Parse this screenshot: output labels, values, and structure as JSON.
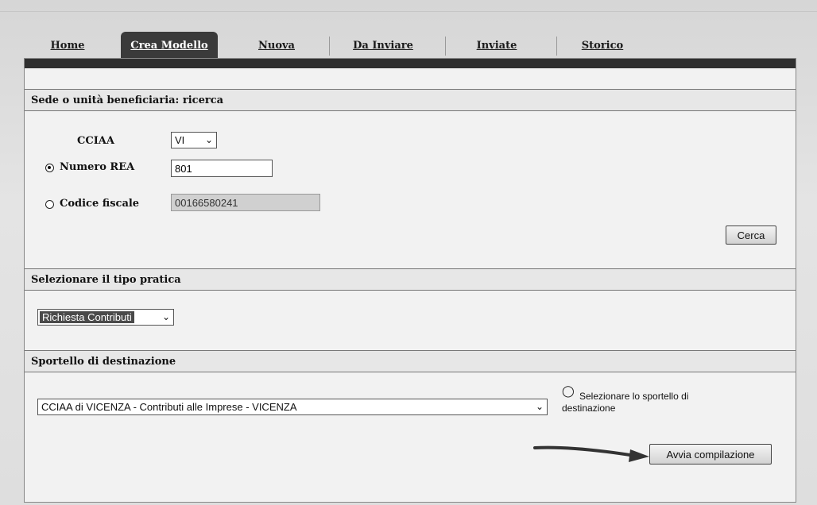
{
  "tabs": [
    {
      "label": "Home",
      "active": false
    },
    {
      "label": "Crea Modello",
      "active": true
    },
    {
      "label": "Nuova",
      "active": false
    },
    {
      "label": "Da Inviare",
      "active": false
    },
    {
      "label": "Inviate",
      "active": false
    },
    {
      "label": "Storico",
      "active": false
    }
  ],
  "search_section": {
    "title": "Sede o unità beneficiaria: ricerca",
    "cciaa_label": "CCIAA",
    "cciaa_value": "VI",
    "rea_label": "Numero REA",
    "rea_value": "801",
    "rea_selected": true,
    "cf_label": "Codice fiscale",
    "cf_value": "00166580241",
    "cf_selected": false,
    "search_button": "Cerca"
  },
  "type_section": {
    "title": "Selezionare il tipo pratica",
    "selected": "Richiesta Contributi"
  },
  "desk_section": {
    "title": "Sportello di destinazione",
    "selected": "CCIAA di VICENZA - Contributi alle Imprese - VICENZA",
    "hint_line1": "Selezionare lo sportello di",
    "hint_line2": "destinazione",
    "start_button": "Avvia compilazione"
  },
  "colors": {
    "active_tab": "#3a3a3a",
    "panel_bar": "#2f2f2f"
  }
}
